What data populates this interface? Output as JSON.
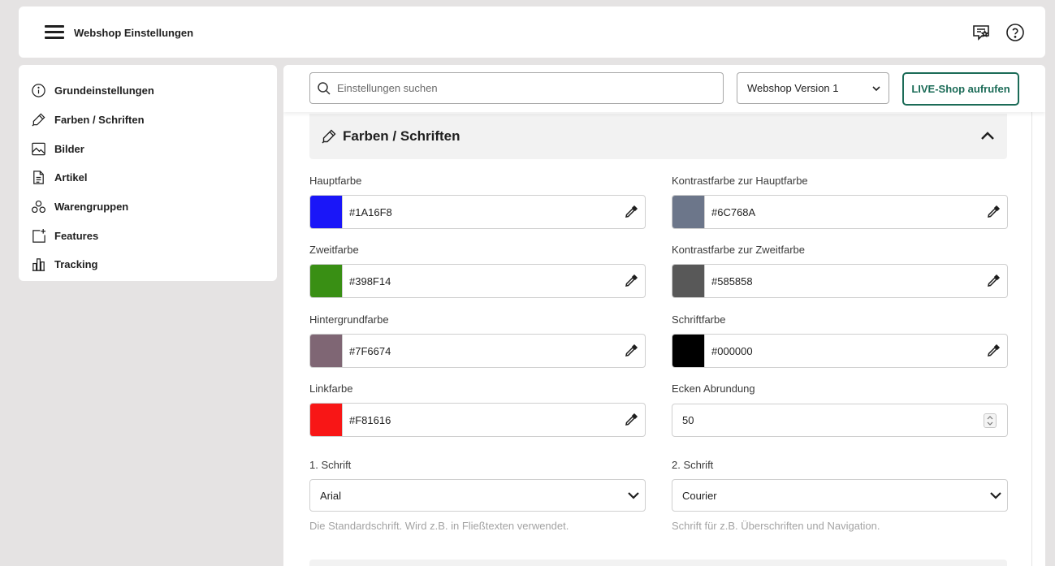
{
  "topbar": {
    "title": "Webshop Einstellungen",
    "menu_icon": "hamburger-menu-icon",
    "review_icon": "review-star-icon",
    "help_icon": "help-icon"
  },
  "sidebar": {
    "items": [
      {
        "label": "Grundeinstellungen",
        "icon": "info-icon"
      },
      {
        "label": "Farben / Schriften",
        "icon": "pen-icon"
      },
      {
        "label": "Bilder",
        "icon": "image-icon"
      },
      {
        "label": "Artikel",
        "icon": "document-icon"
      },
      {
        "label": "Warengruppen",
        "icon": "groups-icon"
      },
      {
        "label": "Features",
        "icon": "add-feature-icon"
      },
      {
        "label": "Tracking",
        "icon": "bar-chart-icon"
      }
    ]
  },
  "toolbar": {
    "search_placeholder": "Einstellungen suchen",
    "version_selected": "Webshop Version 1",
    "live_button": "LIVE-Shop aufrufen"
  },
  "section": {
    "title": "Farben / Schriften",
    "colors": [
      {
        "label": "Hauptfarbe",
        "value": "#1A16F8"
      },
      {
        "label": "Kontrastfarbe zur Hauptfarbe",
        "value": "#6C768A"
      },
      {
        "label": "Zweitfarbe",
        "value": "#398F14"
      },
      {
        "label": "Kontrastfarbe zur Zweitfarbe",
        "value": "#585858"
      },
      {
        "label": "Hintergrundfarbe",
        "value": "#7F6674"
      },
      {
        "label": "Schriftfarbe",
        "value": "#000000"
      },
      {
        "label": "Linkfarbe",
        "value": "#F81616"
      }
    ],
    "corner": {
      "label": "Ecken Abrundung",
      "value": "50"
    },
    "font1": {
      "label": "1. Schrift",
      "value": "Arial",
      "hint": "Die Standardschrift. Wird z.B. in Fließtexten verwendet."
    },
    "font2": {
      "label": "2. Schrift",
      "value": "Courier",
      "hint": "Schrift für z.B. Überschriften und Navigation."
    }
  },
  "colors": {
    "accent": "#1b6b57",
    "panel_bg": "#f2f2f2",
    "page_bg": "#e5e3e3"
  }
}
